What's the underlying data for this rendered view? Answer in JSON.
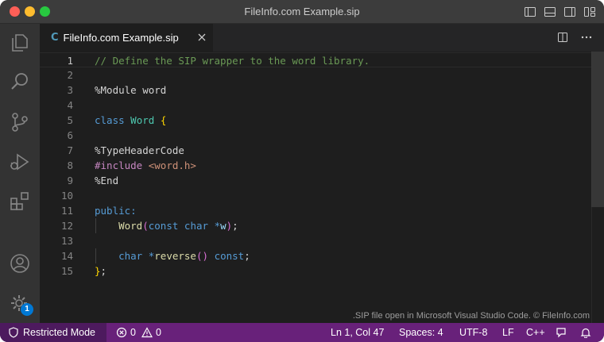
{
  "window": {
    "title": "FileInfo.com Example.sip"
  },
  "tab": {
    "lang_glyph": "C",
    "label": "FileInfo.com Example.sip"
  },
  "editor": {
    "active_line": 1,
    "lines": [
      {
        "n": "1",
        "tokens": [
          [
            "c-comment",
            "// Define the SIP wrapper to the word library."
          ]
        ]
      },
      {
        "n": "2",
        "tokens": []
      },
      {
        "n": "3",
        "tokens": [
          [
            "c-op",
            "%Module word"
          ]
        ]
      },
      {
        "n": "4",
        "tokens": []
      },
      {
        "n": "5",
        "tokens": [
          [
            "c-keyword",
            "class"
          ],
          [
            "c-op",
            " "
          ],
          [
            "c-type",
            "Word"
          ],
          [
            "c-op",
            " "
          ],
          [
            "c-brace",
            "{"
          ]
        ]
      },
      {
        "n": "6",
        "tokens": []
      },
      {
        "n": "7",
        "tokens": [
          [
            "c-op",
            "%TypeHeaderCode"
          ]
        ]
      },
      {
        "n": "8",
        "tokens": [
          [
            "c-preproc",
            "#include"
          ],
          [
            "c-op",
            " "
          ],
          [
            "c-string",
            "<word.h>"
          ]
        ]
      },
      {
        "n": "9",
        "tokens": [
          [
            "c-op",
            "%End"
          ]
        ]
      },
      {
        "n": "10",
        "tokens": []
      },
      {
        "n": "11",
        "tokens": [
          [
            "c-keyword",
            "public:"
          ]
        ]
      },
      {
        "n": "12",
        "tokens": [
          [
            "c-op",
            "    "
          ],
          [
            "c-func",
            "Word"
          ],
          [
            "c-paren",
            "("
          ],
          [
            "c-keyword",
            "const"
          ],
          [
            "c-op",
            " "
          ],
          [
            "c-keyword",
            "char"
          ],
          [
            "c-op",
            " "
          ],
          [
            "c-keyword",
            "*"
          ],
          [
            "c-var",
            "w"
          ],
          [
            "c-paren",
            ")"
          ],
          [
            "c-op",
            ";"
          ]
        ]
      },
      {
        "n": "13",
        "tokens": []
      },
      {
        "n": "14",
        "tokens": [
          [
            "c-op",
            "    "
          ],
          [
            "c-keyword",
            "char"
          ],
          [
            "c-op",
            " "
          ],
          [
            "c-keyword",
            "*"
          ],
          [
            "c-func",
            "reverse"
          ],
          [
            "c-paren",
            "()"
          ],
          [
            "c-op",
            " "
          ],
          [
            "c-keyword",
            "const"
          ],
          [
            "c-op",
            ";"
          ]
        ]
      },
      {
        "n": "15",
        "tokens": [
          [
            "c-brace",
            "}"
          ],
          [
            "c-op",
            ";"
          ]
        ]
      }
    ]
  },
  "watermark": ".SIP file open in Microsoft Visual Studio Code. © FileInfo.com",
  "status": {
    "restricted": "Restricted Mode",
    "errors": "0",
    "warnings": "0",
    "cursor": "Ln 1, Col 47",
    "spaces": "Spaces: 4",
    "encoding": "UTF-8",
    "eol": "LF",
    "language": "C++"
  },
  "activity": {
    "settings_badge": "1"
  },
  "colors": {
    "status_bar": "#68217a",
    "restricted_bg": "#4d1a5e",
    "badge": "#0078d4"
  }
}
